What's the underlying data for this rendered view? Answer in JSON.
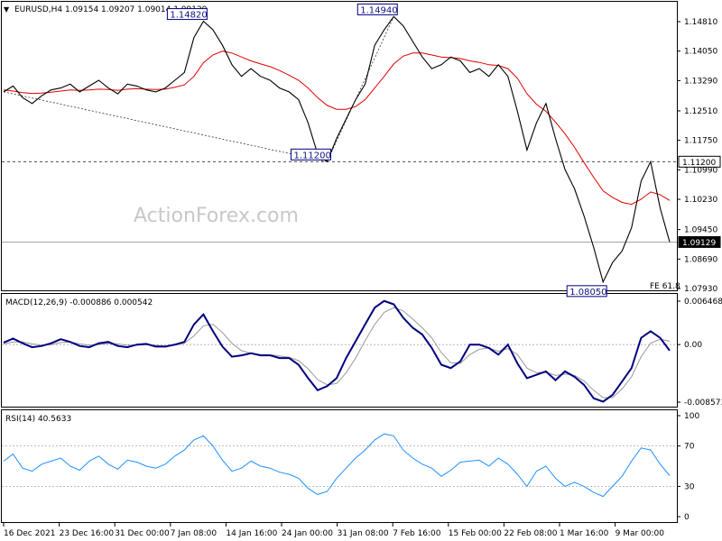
{
  "header": {
    "title": "EURUSD,H4  1.09154 1.09207 1.09014 1.09129",
    "macd_label": "MACD(12,26,9) -0.000886 0.000542",
    "rsi_label": "RSI(14) 40.5633",
    "watermark": "ActionForex.com",
    "fe_label": "FE 61.8"
  },
  "colors": {
    "price": "#000000",
    "ma": "#e00000",
    "macd": "#000080",
    "signal": "#999999",
    "rsi": "#1e90ff",
    "annotation_border": "#000080"
  },
  "chart_data": [
    {
      "type": "line",
      "panel": "price",
      "title": "EURUSD,H4",
      "ylim": [
        1.0793,
        1.1481
      ],
      "y_ticks": [
        "1.14810",
        "1.14050",
        "1.13290",
        "1.12510",
        "1.11750",
        "1.10990",
        "1.10230",
        "1.09450",
        "1.08690",
        "1.07930"
      ],
      "x_ticks": [
        "16 Dec 2021",
        "23 Dec 16:00",
        "31 Dec 00:00",
        "7 Jan 08:00",
        "14 Jan 16:00",
        "24 Jan 00:00",
        "31 Jan 08:00",
        "7 Feb 16:00",
        "15 Feb 00:00",
        "22 Feb 08:00",
        "1 Mar 16:00",
        "9 Mar 00:00"
      ],
      "series": [
        {
          "values": [
            1.13,
            1.1315,
            1.1285,
            1.127,
            1.129,
            1.1305,
            1.131,
            1.132,
            1.13,
            1.1315,
            1.133,
            1.131,
            1.1295,
            1.132,
            1.1315,
            1.1305,
            1.13,
            1.131,
            1.133,
            1.135,
            1.144,
            1.1482,
            1.146,
            1.142,
            1.137,
            1.134,
            1.136,
            1.134,
            1.133,
            1.131,
            1.13,
            1.128,
            1.122,
            1.114,
            1.112,
            1.118,
            1.123,
            1.128,
            1.132,
            1.142,
            1.146,
            1.1494,
            1.147,
            1.143,
            1.139,
            1.136,
            1.137,
            1.139,
            1.138,
            1.135,
            1.136,
            1.134,
            1.137,
            1.134,
            1.125,
            1.115,
            1.122,
            1.127,
            1.118,
            1.11,
            1.105,
            1.098,
            1.09,
            1.081,
            1.086,
            1.089,
            1.095,
            1.107,
            1.112,
            1.1,
            1.0913
          ]
        },
        {
          "values": [
            1.1305,
            1.1302,
            1.1298,
            1.1296,
            1.1297,
            1.1299,
            1.1302,
            1.1305,
            1.1304,
            1.1305,
            1.1307,
            1.1306,
            1.1304,
            1.1307,
            1.1308,
            1.1307,
            1.1306,
            1.1307,
            1.1312,
            1.1318,
            1.134,
            1.1375,
            1.1395,
            1.1405,
            1.14,
            1.139,
            1.138,
            1.1372,
            1.1365,
            1.1355,
            1.1343,
            1.133,
            1.131,
            1.1285,
            1.1265,
            1.1255,
            1.1255,
            1.1262,
            1.128,
            1.131,
            1.134,
            1.1372,
            1.1392,
            1.14,
            1.14,
            1.1395,
            1.139,
            1.1388,
            1.1386,
            1.138,
            1.1376,
            1.137,
            1.1368,
            1.136,
            1.1335,
            1.1295,
            1.1268,
            1.125,
            1.1222,
            1.1192,
            1.1157,
            1.1118,
            1.108,
            1.1045,
            1.1028,
            1.1015,
            1.101,
            1.1023,
            1.1042,
            1.1035,
            1.102
          ]
        }
      ],
      "annotations": [
        {
          "text": "1.14820",
          "x": 21,
          "y": 1.1482
        },
        {
          "text": "1.11200",
          "x": 34,
          "y": 1.112
        },
        {
          "text": "1.14940",
          "x": 41,
          "y": 1.1494
        },
        {
          "text": "1.08050",
          "x": 63,
          "y": 1.0805
        }
      ],
      "hlines": [
        {
          "y": 1.112,
          "label": "1.11200",
          "style": "dashed"
        },
        {
          "y": 1.09129,
          "label": "1.09129",
          "style": "solid"
        }
      ],
      "trendlines": [
        {
          "from": [
            0,
            1.13
          ],
          "to": [
            34,
            1.112
          ]
        },
        {
          "from": [
            34,
            1.112
          ],
          "to": [
            41,
            1.1494
          ]
        }
      ]
    },
    {
      "type": "line",
      "panel": "macd",
      "title": "MACD(12,26,9)",
      "ylim": [
        -0.008573,
        0.006468
      ],
      "y_ticks": [
        "0.006468",
        "0.00",
        "-0.008573"
      ],
      "series": [
        {
          "values": [
            0.0003,
            0.0009,
            0.0002,
            -0.0004,
            -0.0002,
            0.0002,
            0.0008,
            0.0004,
            -0.0002,
            -0.0004,
            0.0002,
            0.0004,
            -0.0002,
            -0.0004,
            0.0,
            0.0001,
            -0.0003,
            -0.0003,
            0.0,
            0.0004,
            0.003,
            0.0045,
            0.002,
            -0.0003,
            -0.0018,
            -0.0016,
            -0.0013,
            -0.0016,
            -0.0016,
            -0.002,
            -0.002,
            -0.003,
            -0.005,
            -0.0068,
            -0.0062,
            -0.005,
            -0.002,
            0.0005,
            0.003,
            0.0055,
            0.0065,
            0.006,
            0.004,
            0.0025,
            0.0015,
            -0.0005,
            -0.003,
            -0.0035,
            -0.0025,
            0.0,
            0.0,
            -0.0005,
            -0.0015,
            0.0,
            -0.0028,
            -0.005,
            -0.0045,
            -0.004,
            -0.0053,
            -0.004,
            -0.0048,
            -0.006,
            -0.008,
            -0.0085,
            -0.0075,
            -0.0055,
            -0.0035,
            0.001,
            0.002,
            0.001,
            -0.0009
          ]
        },
        {
          "values": [
            0.0001,
            0.0004,
            0.0004,
            0.0001,
            -0.0001,
            0.0,
            0.0003,
            0.0004,
            0.0001,
            -0.0001,
            0.0,
            0.0002,
            0.0001,
            -0.0001,
            -0.0001,
            0.0,
            -0.0001,
            -0.0002,
            -0.0001,
            0.0002,
            0.0013,
            0.0028,
            0.003,
            0.0018,
            0.0002,
            -0.0009,
            -0.0013,
            -0.0015,
            -0.0015,
            -0.0017,
            -0.0019,
            -0.0024,
            -0.0036,
            -0.0052,
            -0.006,
            -0.0058,
            -0.0042,
            -0.002,
            0.0006,
            0.003,
            0.0048,
            0.0055,
            0.005,
            0.0038,
            0.0025,
            0.001,
            -0.0012,
            -0.0027,
            -0.0028,
            -0.0015,
            -0.0007,
            -0.0005,
            -0.001,
            -0.0006,
            -0.0015,
            -0.0035,
            -0.0042,
            -0.0041,
            -0.0046,
            -0.0044,
            -0.0046,
            -0.0054,
            -0.0068,
            -0.0079,
            -0.0079,
            -0.0066,
            -0.0048,
            -0.0018,
            0.0002,
            0.0008,
            0.0005
          ]
        }
      ]
    },
    {
      "type": "line",
      "panel": "rsi",
      "title": "RSI(14)",
      "ylim": [
        0,
        100
      ],
      "y_ticks": [
        "100",
        "70",
        "30",
        "0"
      ],
      "hlines": [
        70,
        30
      ],
      "series": [
        {
          "values": [
            55,
            62,
            48,
            45,
            52,
            55,
            58,
            50,
            46,
            55,
            60,
            52,
            47,
            56,
            54,
            50,
            48,
            52,
            60,
            66,
            76,
            80,
            70,
            56,
            45,
            48,
            55,
            50,
            48,
            44,
            42,
            38,
            28,
            22,
            25,
            38,
            48,
            58,
            66,
            76,
            82,
            80,
            66,
            58,
            52,
            48,
            40,
            46,
            54,
            55,
            56,
            50,
            58,
            52,
            42,
            30,
            45,
            50,
            38,
            30,
            34,
            30,
            24,
            20,
            30,
            40,
            55,
            68,
            66,
            52,
            40.6
          ]
        }
      ]
    }
  ]
}
